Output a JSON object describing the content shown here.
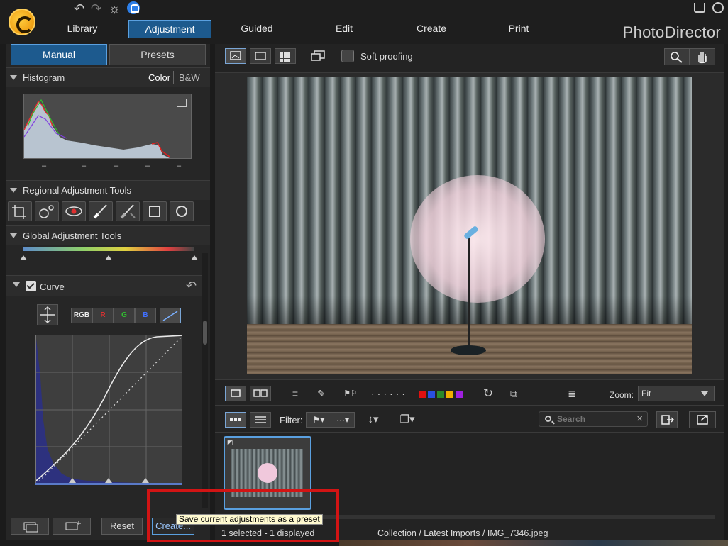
{
  "app": {
    "brand": "PhotoDirector",
    "nav_tabs": [
      {
        "label": "Library"
      },
      {
        "label": "Adjustment"
      },
      {
        "label": "Guided"
      },
      {
        "label": "Edit"
      },
      {
        "label": "Create"
      },
      {
        "label": "Print"
      }
    ],
    "active_tab": "Adjustment"
  },
  "left_panel": {
    "tabs": [
      {
        "label": "Manual"
      },
      {
        "label": "Presets"
      }
    ],
    "histogram": {
      "title": "Histogram",
      "modes": [
        "Color",
        "B&W"
      ],
      "ticks": [
        "–",
        "–",
        "–",
        "–",
        "–"
      ]
    },
    "regional": {
      "title": "Regional Adjustment Tools",
      "tools": [
        "crop-icon",
        "spot-removal-icon",
        "red-eye-icon",
        "brush-icon",
        "gradient-brush-icon",
        "square-mask-icon",
        "radial-mask-icon"
      ]
    },
    "global": {
      "title": "Global Adjustment Tools"
    },
    "curve": {
      "title": "Curve",
      "enabled": true,
      "channels": [
        "RGB",
        "R",
        "G",
        "B"
      ]
    },
    "bottom_buttons": {
      "reset": "Reset",
      "create": "Create..."
    }
  },
  "viewer": {
    "soft_proofing": "Soft proofing",
    "zoom_label": "Zoom:",
    "zoom_value": "Fit",
    "color_labels": [
      "#e01010",
      "#2a50e0",
      "#2a8a2a",
      "#f0b000",
      "#a020e0"
    ],
    "accent": "#5aa0e0"
  },
  "filmstrip": {
    "filter_label": "Filter:",
    "search_placeholder": "Search"
  },
  "status": {
    "selection": "1 selected - 1 displayed",
    "path": "Collection / Latest Imports / IMG_7346.jpeg"
  },
  "tooltip": {
    "text": "Save current adjustments as a preset"
  }
}
